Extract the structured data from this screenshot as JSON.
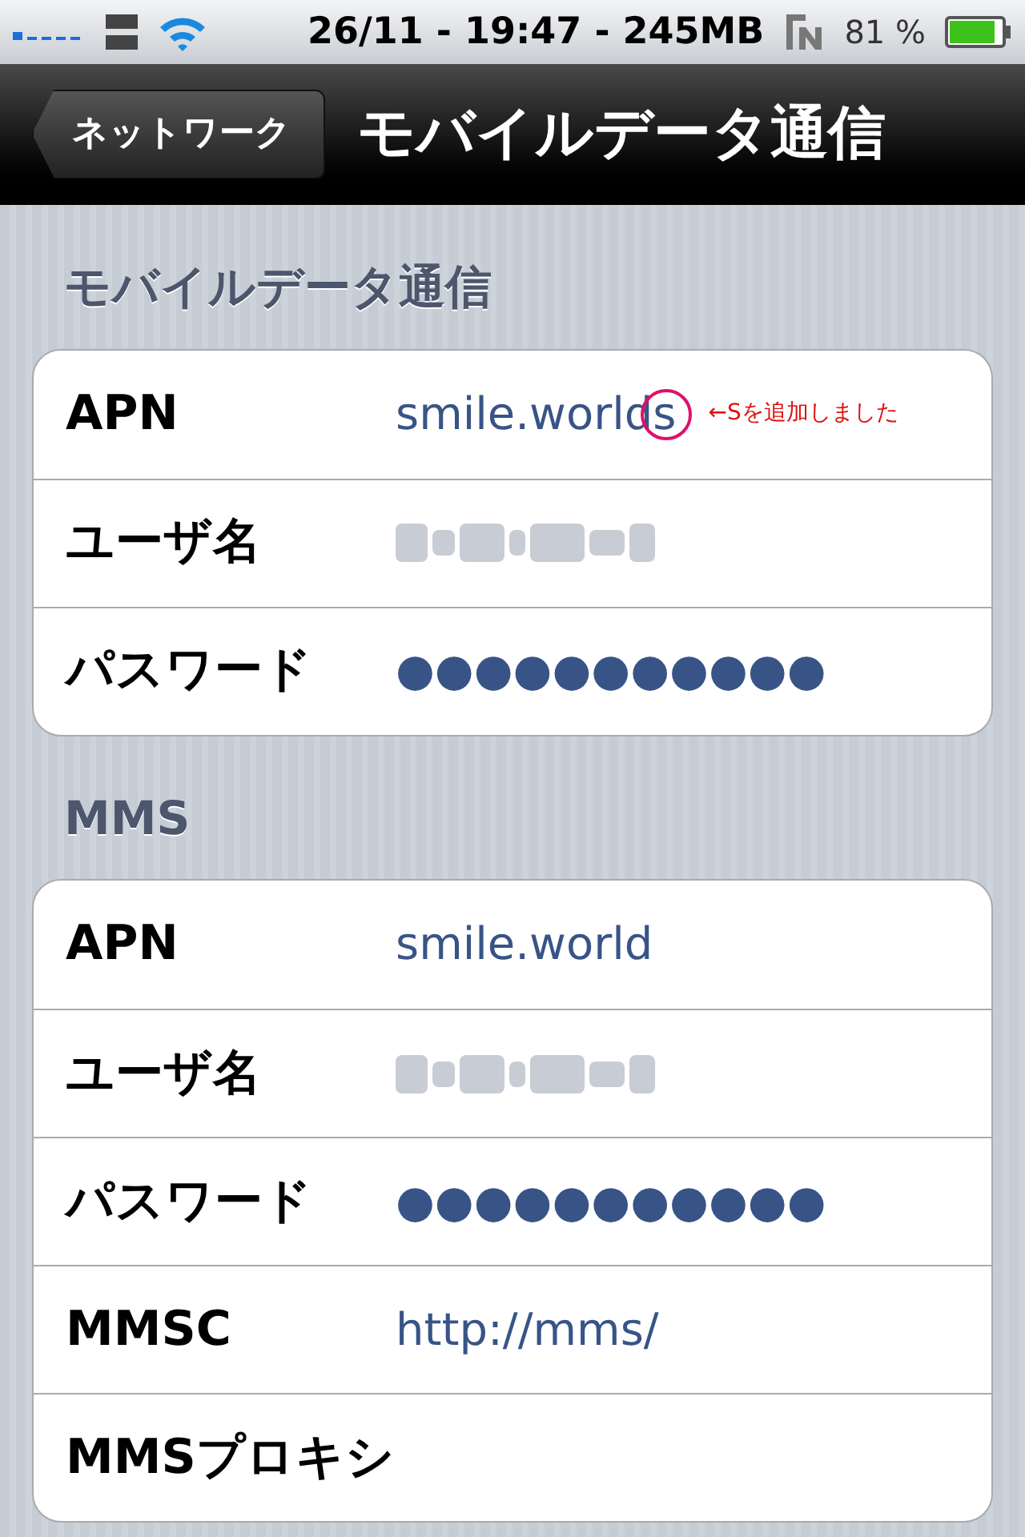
{
  "status_bar": {
    "time": "26/11 - 19:47 - 245MB",
    "battery": "81 %"
  },
  "nav_bar": {
    "back": "ネットワーク",
    "title": "モバイルデータ通信"
  },
  "sections": [
    {
      "header": "モバイルデータ通信",
      "rows": [
        {
          "label": "APN",
          "kind": "text",
          "value": "smile.worlds",
          "annotation": "←Sを追加しました"
        },
        {
          "label": "ユーザ名",
          "kind": "redacted"
        },
        {
          "label": "パスワード",
          "kind": "text",
          "value": "●●●●●●●●●●●"
        }
      ]
    },
    {
      "header": "MMS",
      "rows": [
        {
          "label": "APN",
          "kind": "text",
          "value": "smile.world"
        },
        {
          "label": "ユーザ名",
          "kind": "redacted"
        },
        {
          "label": "パスワード",
          "kind": "text",
          "value": "●●●●●●●●●●●"
        },
        {
          "label": "MMSC",
          "kind": "text",
          "value": "http://mms/"
        },
        {
          "label": "MMSプロキシ",
          "kind": "empty"
        }
      ]
    }
  ]
}
